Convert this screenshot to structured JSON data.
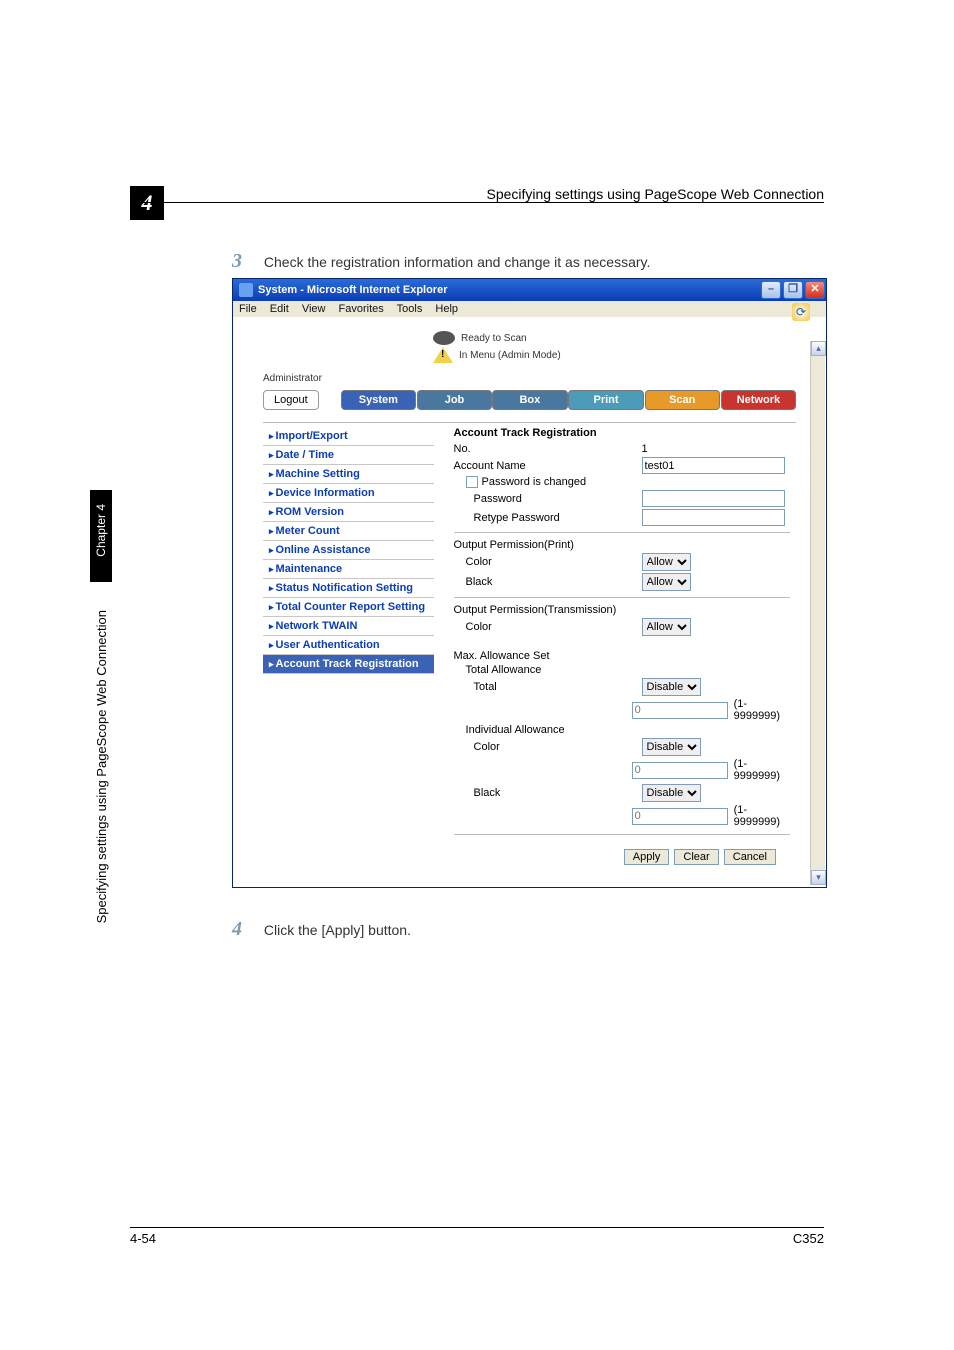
{
  "page": {
    "chapter_num_box": "4",
    "header_text": "Specifying settings using PageScope Web Connection",
    "vertical_label": "Specifying settings using PageScope Web Connection",
    "chapter_box": "Chapter 4",
    "footer_left": "4-54",
    "footer_right": "C352",
    "steps": {
      "s3_num": "3",
      "s3_text": "Check the registration information and change it as necessary.",
      "s4_num": "4",
      "s4_text": "Click the [Apply] button."
    }
  },
  "win": {
    "title": "System - Microsoft Internet Explorer",
    "menus": [
      "File",
      "Edit",
      "View",
      "Favorites",
      "Tools",
      "Help"
    ],
    "status": {
      "ready": "Ready to Scan",
      "mode": "In Menu (Admin Mode)",
      "admin": "Administrator"
    },
    "logout": "Logout",
    "tabs": {
      "system": "System",
      "job": "Job",
      "box": "Box",
      "print": "Print",
      "scan": "Scan",
      "network": "Network"
    },
    "sidebar": [
      "Import/Export",
      "Date / Time",
      "Machine Setting",
      "Device Information",
      "ROM Version",
      "Meter Count",
      "Online Assistance",
      "Maintenance",
      "Status Notification Setting",
      "Total Counter Report Setting",
      "Network TWAIN",
      "User Authentication",
      "Account Track Registration"
    ],
    "panel": {
      "title": "Account Track Registration",
      "no_label": "No.",
      "no_value": "1",
      "accname_label": "Account Name",
      "accname_value": "test01",
      "pwchg_label": "Password is changed",
      "pw_label": "Password",
      "rpw_label": "Retype Password",
      "op_print_title": "Output Permission(Print)",
      "color_label": "Color",
      "black_label": "Black",
      "allow": "Allow",
      "op_trans_title": "Output Permission(Transmission)",
      "max_title": "Max. Allowance Set",
      "tot_allow": "Total Allowance",
      "total_label": "Total",
      "disable": "Disable",
      "range": "(1-9999999)",
      "indiv_title": "Individual Allowance",
      "apply": "Apply",
      "clear": "Clear",
      "cancel": "Cancel",
      "num_placeholder": "0"
    }
  }
}
